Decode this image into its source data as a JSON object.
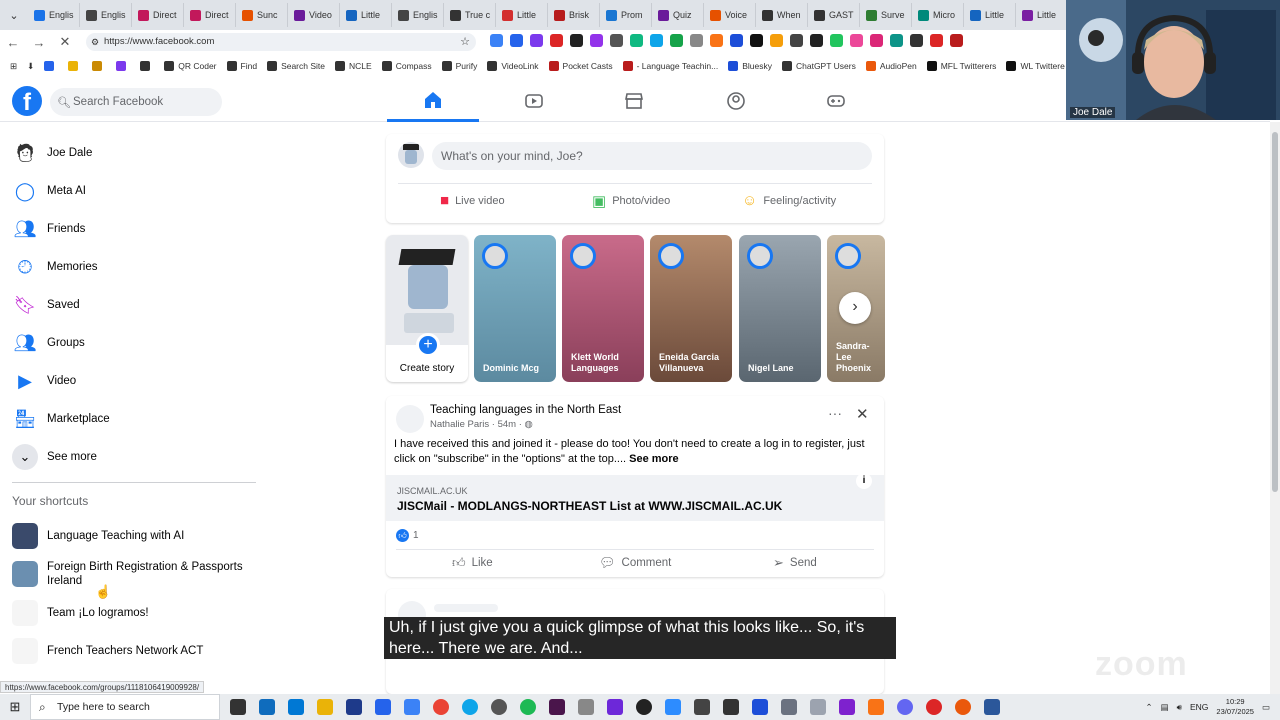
{
  "browser": {
    "tabs": [
      "Englis",
      "Englis",
      "Direct",
      "Direct",
      "Sunc",
      "Video",
      "Little",
      "Englis",
      "True c",
      "Little",
      "Brisk",
      "Prom",
      "Quiz",
      "Voice",
      "When",
      "GAST",
      "Surve",
      "Micro",
      "Little",
      "Little"
    ],
    "url": "https://www.facebook.com",
    "bookmarks": [
      "QR Coder",
      "Find",
      "Search Site",
      "NCLE",
      "Compass",
      "Purify",
      "VideoLink",
      "Pocket Casts",
      "- Language Teachin...",
      "Bluesky",
      "ChatGPT Users",
      "AudioPen",
      "MFL Twitterers",
      "WL Twitterers"
    ],
    "status_url": "https://www.facebook.com/groups/1118106419009928/"
  },
  "facebook": {
    "logo": "f",
    "search_placeholder": "Search Facebook",
    "sidebar": [
      {
        "label": "Joe Dale",
        "icon": "profile-avatar-icon"
      },
      {
        "label": "Meta AI",
        "icon": "meta-ai-icon"
      },
      {
        "label": "Friends",
        "icon": "friends-icon"
      },
      {
        "label": "Memories",
        "icon": "memories-clock-icon"
      },
      {
        "label": "Saved",
        "icon": "bookmark-icon"
      },
      {
        "label": "Groups",
        "icon": "groups-icon"
      },
      {
        "label": "Video",
        "icon": "video-icon"
      },
      {
        "label": "Marketplace",
        "icon": "marketplace-icon"
      },
      {
        "label": "See more",
        "icon": "chevron-down-icon"
      }
    ],
    "shortcuts_title": "Your shortcuts",
    "shortcuts": [
      "Language Teaching with AI",
      "Foreign Birth Registration & Passports Ireland",
      "Team ¡Lo logramos!",
      "French Teachers Network ACT"
    ],
    "composer": {
      "placeholder": "What's on your mind, Joe?",
      "live": "Live video",
      "photo": "Photo/video",
      "feeling": "Feeling/activity"
    },
    "stories": {
      "create": "Create story",
      "items": [
        "Dominic Mcg",
        "Klett World Languages",
        "Eneida Garcia Villanueva",
        "Nigel Lane",
        "Sandra-Lee Phoenix"
      ]
    },
    "post": {
      "group": "Teaching languages in the North East",
      "author": "Nathalie Paris",
      "time": "54m",
      "text": "I have received this and joined it - please do too! You don't need to create a log in to register, just click on \"subscribe\" in the \"options\" at the top....",
      "see_more": "See more",
      "link_domain": "JISCMAIL.AC.UK",
      "link_title": "JISCMail - MODLANGS-NORTHEAST List at WWW.JISCMAIL.AC.UK",
      "reactions": "1",
      "like": "Like",
      "comment": "Comment",
      "send": "Send"
    }
  },
  "webcam": {
    "name": "Joe Dale"
  },
  "caption": "Uh, if I just give you a quick glimpse of what this looks like... So, it's here... There we are. And...",
  "taskbar": {
    "search": "Type here to search",
    "lang": "ENG",
    "time": "10:29",
    "date": "23/07/2025"
  },
  "colors": {
    "facebook_blue": "#1877f2",
    "caption_bg": "#141414"
  }
}
